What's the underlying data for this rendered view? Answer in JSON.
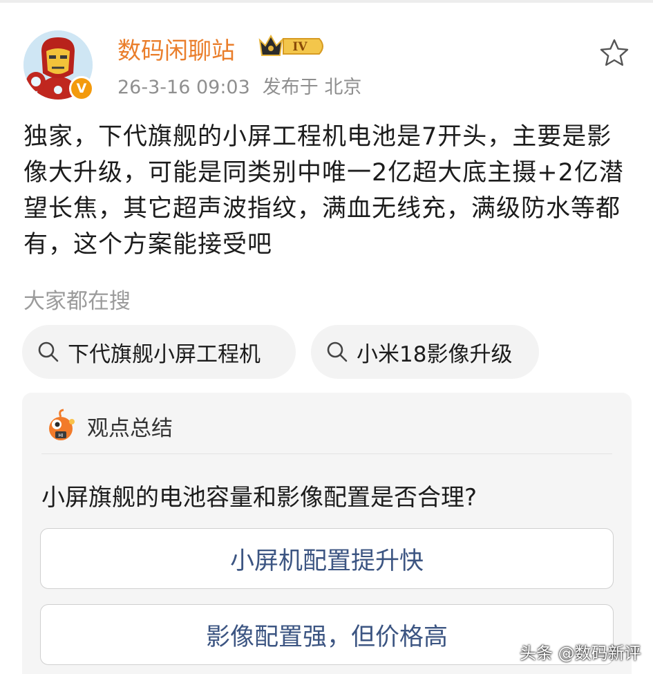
{
  "post": {
    "author": "数码闲聊站",
    "level_badge": "IV",
    "verified_badge": "V",
    "time": "26-3-16 09:03",
    "location": "发布于 北京",
    "content": "独家，下代旗舰的小屏工程机电池是7开头，主要是影像大升级，可能是同类别中唯一2亿超大底主摄+2亿潜望长焦，其它超声波指纹，满血无线充，满级防水等都有，这个方案能接受吧"
  },
  "search": {
    "heading": "大家都在搜",
    "chips": [
      "下代旗舰小屏工程机",
      "小米18影像升级"
    ]
  },
  "summary": {
    "title": "观点总结",
    "question": "小屏旗舰的电池容量和影像配置是否合理?",
    "options": [
      "小屏机配置提升快",
      "影像配置强，但价格高"
    ]
  },
  "watermark": "头条 @数码新评",
  "icons": {
    "favorite": "star-icon",
    "search": "search-icon",
    "level": "crown-level-icon",
    "mascot": "mascot-icon"
  },
  "colors": {
    "username": "#ea7e2b",
    "badge": "#f39a0d",
    "option_text": "#3c5582"
  }
}
